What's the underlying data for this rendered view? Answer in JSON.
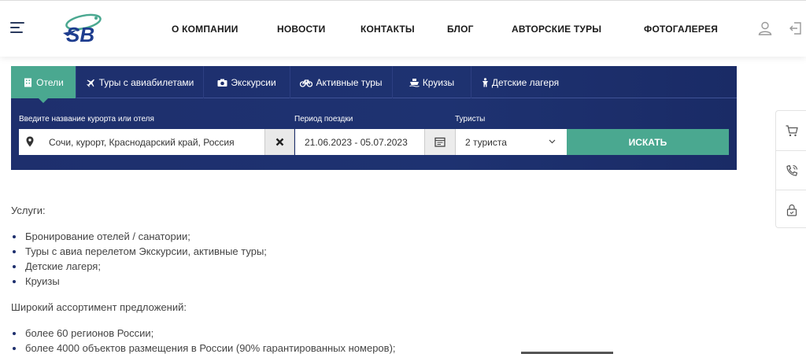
{
  "header": {
    "nav": [
      {
        "key": "about",
        "label": "О КОМПАНИИ"
      },
      {
        "key": "news",
        "label": "НОВОСТИ"
      },
      {
        "key": "contacts",
        "label": "КОНТАКТЫ"
      },
      {
        "key": "blog",
        "label": "БЛОГ"
      },
      {
        "key": "tours",
        "label": "АВТОРСКИЕ ТУРЫ"
      },
      {
        "key": "gallery",
        "label": "ФОТОГАЛЕРЕЯ"
      }
    ],
    "logo_text": "SB"
  },
  "widget": {
    "tabs": [
      {
        "label": "Отели",
        "icon": "building-icon",
        "active": true
      },
      {
        "label": "Туры с авиабилетами",
        "icon": "plane-icon",
        "active": false
      },
      {
        "label": "Экскурсии",
        "icon": "camera-icon",
        "active": false
      },
      {
        "label": "Активные туры",
        "icon": "bicycle-icon",
        "active": false
      },
      {
        "label": "Круизы",
        "icon": "ship-icon",
        "active": false
      },
      {
        "label": "Детские лагеря",
        "icon": "child-icon",
        "active": false
      }
    ],
    "destination": {
      "label": "Введите название курорта или отеля",
      "value": "Сочи, курорт, Краснодарский край, Россия"
    },
    "period": {
      "label": "Период поездки",
      "value": "21.06.2023 - 05.07.2023"
    },
    "tourists": {
      "label": "Туристы",
      "value": "2 туриста"
    },
    "search_label": "ИСКАТЬ",
    "accent_color": "#4aa890",
    "bg_color": "#1e2f6d"
  },
  "content": {
    "services_title": "Услуги:",
    "services": [
      "Бронирование отелей / санатории;",
      "Туры с авиа перелетом Экскурсии, активные туры;",
      "Детские лагеря;",
      "Круизы"
    ],
    "assortment_title": "Широкий ассортимент предложений:",
    "assortment": [
      "более 60 регионов России;",
      "более 4000 объектов размещения в России (90% гарантированных номеров);"
    ]
  },
  "side_panel": {
    "icons": [
      "cart-icon",
      "phone-icon",
      "lock-icon"
    ]
  }
}
